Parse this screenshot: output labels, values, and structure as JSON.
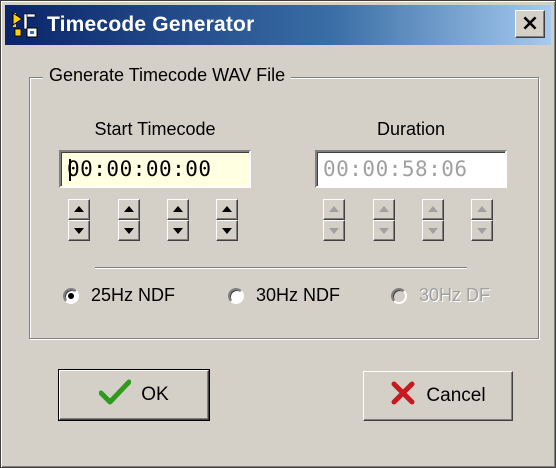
{
  "window": {
    "title": "Timecode Generator",
    "close_glyph": "×",
    "icon": "timecode-app-icon"
  },
  "group": {
    "legend": "Generate Timecode WAV File"
  },
  "start": {
    "label": "Start Timecode",
    "value": "00:00:00:00"
  },
  "duration": {
    "label": "Duration",
    "value": "00:00:58:06",
    "enabled": false
  },
  "radios": [
    {
      "label": "25Hz NDF",
      "checked": true,
      "enabled": true
    },
    {
      "label": "30Hz NDF",
      "checked": false,
      "enabled": true
    },
    {
      "label": "30Hz DF",
      "checked": false,
      "enabled": false
    }
  ],
  "buttons": {
    "ok_label": "OK",
    "cancel_label": "Cancel"
  },
  "icons": {
    "ok": "check-icon",
    "cancel": "x-icon",
    "spin_up": "arrow-up-icon",
    "spin_down": "arrow-down-icon"
  },
  "colors": {
    "title_start": "#0a246a",
    "title_end": "#a6caf0",
    "face": "#d4d0c8",
    "field_highlight": "#ffffe1",
    "ok_check": "#2e9b1e",
    "cancel_x": "#c8191e",
    "disabled_text": "#a0a0a0"
  }
}
